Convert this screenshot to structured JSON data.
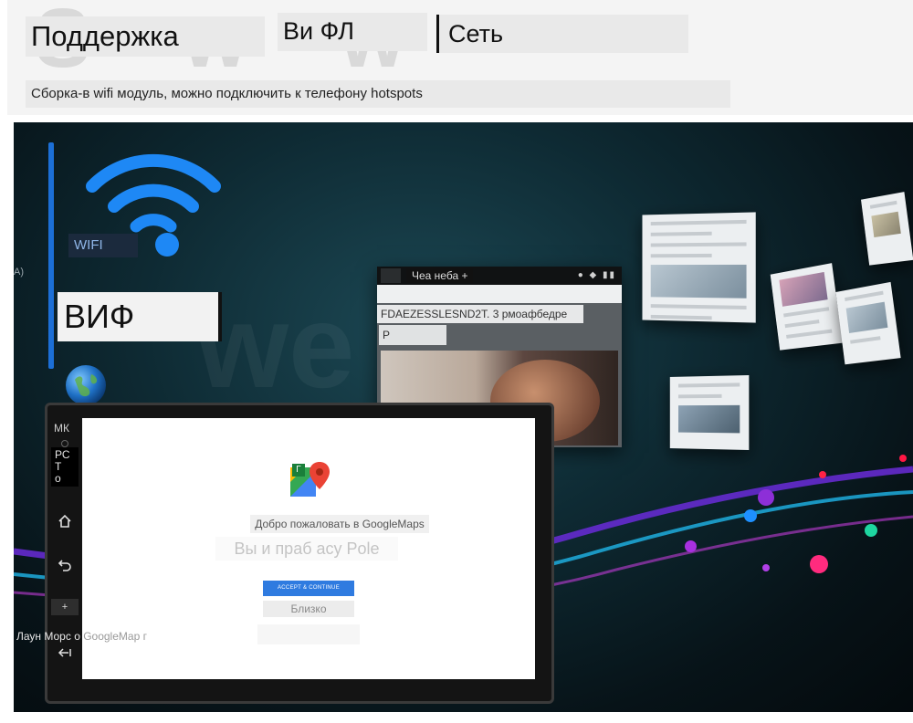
{
  "header": {
    "title_support": "Поддержка",
    "title_vi_fl": "Ви ФЛ",
    "title_network": "Сеть",
    "subtitle": "Сборка-в wifi модуль, можно подключить к телефону hotspots"
  },
  "banner": {
    "wifi_label": "WIFI",
    "left_edge_text": "A)",
    "big_label": "ВИФ",
    "browser": {
      "status_text": "Чеа неба +",
      "caption": "FDAEZESSLESND2T. 3 рмоафбедре",
      "p_label": "Р"
    }
  },
  "head_unit": {
    "side": {
      "mk_label": "МК",
      "rst_label": "РС\nТ\nо",
      "plus_label": "+"
    },
    "screen": {
      "maps_badge": "Г",
      "welcome_text": "Добро пожаловать в GoogleMaps",
      "subtext": "Вы и праб асу Pole",
      "accept_button": "ACCEPT & CONTINUE",
      "close_button": "Близко"
    },
    "launch_label_main": "Лаун Морс о ",
    "launch_label_faded": "GoogleMap г"
  },
  "colors": {
    "accent_blue": "#1c6fd6",
    "wifi_blue": "#1e88f5",
    "accept_blue": "#2f7be0"
  }
}
